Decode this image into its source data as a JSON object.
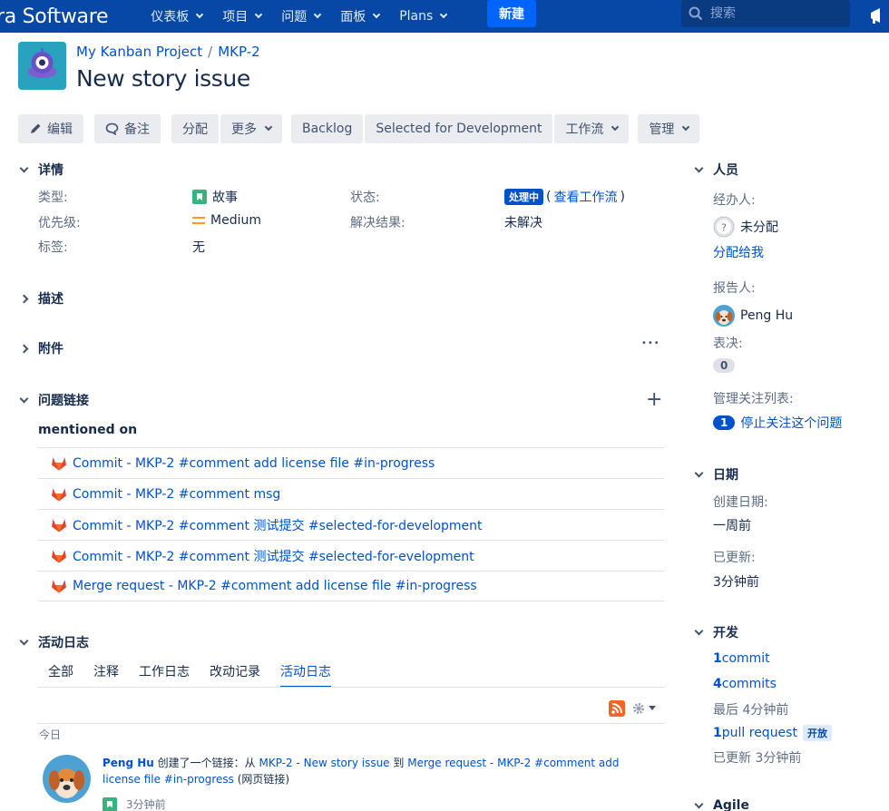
{
  "topnav": {
    "brand": "ra Software",
    "items": [
      {
        "label": "仪表板"
      },
      {
        "label": "项目"
      },
      {
        "label": "问题"
      },
      {
        "label": "面板"
      },
      {
        "label": "Plans"
      }
    ],
    "create_label": "新建",
    "search_placeholder": "搜索"
  },
  "header": {
    "project": "My Kanban Project",
    "separator": "/",
    "issue_key": "MKP-2",
    "title": "New story issue"
  },
  "toolbar": {
    "edit": "编辑",
    "comment": "备注",
    "assign": "分配",
    "more": "更多",
    "backlog": "Backlog",
    "selected": "Selected for Development",
    "workflow": "工作流",
    "admin": "管理"
  },
  "details": {
    "heading": "详情",
    "type_label": "类型:",
    "type_value": "故事",
    "priority_label": "优先级:",
    "priority_value": "Medium",
    "labels_label": "标签:",
    "labels_value": "无",
    "status_label": "状态:",
    "status_value": "处理中",
    "status_open_paren": "(",
    "status_link": "查看工作流",
    "status_close_paren": ")",
    "resolution_label": "解决结果:",
    "resolution_value": "未解决"
  },
  "description": {
    "heading": "描述"
  },
  "attachments": {
    "heading": "附件",
    "more": "•••"
  },
  "issue_links": {
    "heading": "问题链接",
    "add": "+",
    "group": "mentioned on",
    "rows": [
      {
        "text": "Commit - MKP-2 #comment add license file #in-progress"
      },
      {
        "text": "Commit - MKP-2 #comment msg"
      },
      {
        "text": "Commit - MKP-2 #comment 测试提交 #selected-for-development"
      },
      {
        "text": "Commit - MKP-2 #comment 测试提交 #selected-for-evelopment"
      },
      {
        "text": "Merge request - MKP-2 #comment add license file #in-progress"
      }
    ]
  },
  "activity": {
    "heading": "活动日志",
    "tabs": [
      "全部",
      "注释",
      "工作日志",
      "改动记录",
      "活动日志"
    ],
    "today": "今日",
    "entry_user": "Peng Hu",
    "entry_action": " 创建了一个链接：从 ",
    "entry_from": "MKP-2 - New story issue",
    "entry_to_word": " 到 ",
    "entry_to": "Merge request - MKP-2 #comment add",
    "entry_to2": "license file #in-progress",
    "entry_suffix": " (网页链接)",
    "entry_time": "3分钟前"
  },
  "people": {
    "heading": "人员",
    "assignee_label": "经办人:",
    "assignee_value": "未分配",
    "assign_to_me": "分配给我",
    "reporter_label": "报告人:",
    "reporter_value": "Peng Hu",
    "votes_label": "表决:",
    "votes_value": "0",
    "watchers_label": "管理关注列表:",
    "watchers_count": "1",
    "watchers_action": "停止关注这个问题"
  },
  "dates": {
    "heading": "日期",
    "created_label": "创建日期:",
    "created_value": "一周前",
    "updated_label": "已更新:",
    "updated_value": "3分钟前"
  },
  "development": {
    "heading": "开发",
    "commit1_num": "1",
    "commit1_text": " commit",
    "commit4_num": "4",
    "commit4_text": " commits",
    "latest": "最后 4分钟前",
    "pr_num": "1",
    "pr_text": "pull request",
    "pr_status": "开放",
    "pr_updated": "已更新 3分钟前"
  },
  "agile": {
    "heading": "Agile"
  },
  "colors": {
    "nav_bg": "#0747a6",
    "link": "#0052cc",
    "status": "#0052cc",
    "story": "#36b37e",
    "priority": "#ff991f",
    "gitlab": "#e24329"
  }
}
